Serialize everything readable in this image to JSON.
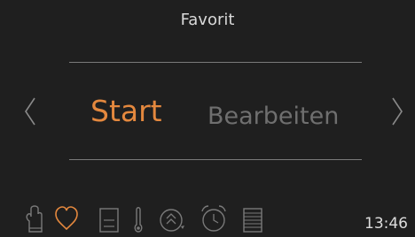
{
  "header": {
    "title": "Favorit"
  },
  "carousel": {
    "options": [
      {
        "label": "Start",
        "state": "selected"
      },
      {
        "label": "Bearbeiten",
        "state": "inactive"
      }
    ]
  },
  "status": {
    "time": "13:46"
  },
  "colors": {
    "background": "#1f1f1f",
    "accent": "#e4883e",
    "inactive": "#6f6f6f",
    "text": "#d9d9d9"
  },
  "bottom_icons": [
    "oven-mitt-icon",
    "heart-icon",
    "door-panel-icon",
    "thermometer-icon",
    "circular-arrows-icon",
    "alarm-clock-icon",
    "menu-list-icon"
  ]
}
